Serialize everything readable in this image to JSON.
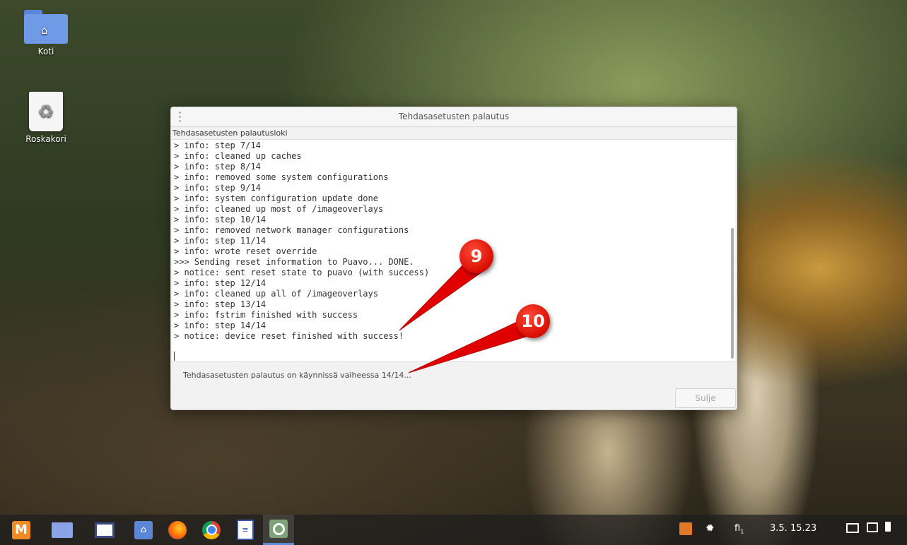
{
  "desktop": {
    "icons": [
      {
        "label": "Koti",
        "icon": "home-folder-icon"
      },
      {
        "label": "Roskakori",
        "icon": "trash-icon"
      }
    ]
  },
  "dialog": {
    "title": "Tehdasasetusten palautus",
    "log_label": "Tehdasasetusten palautusloki",
    "log_lines": [
      "> info: step 7/14",
      "> info: cleaned up caches",
      "> info: step 8/14",
      "> info: removed some system configurations",
      "> info: step 9/14",
      "> info: system configuration update done",
      "> info: cleaned up most of /imageoverlays",
      "> info: step 10/14",
      "> info: removed network manager configurations",
      "> info: step 11/14",
      "> info: wrote reset override",
      ">>> Sending reset information to Puavo... DONE.",
      "> notice: sent reset state to puavo (with success)",
      "> info: step 12/14",
      "> info: cleaned up all of /imageoverlays",
      "> info: step 13/14",
      "> info: fstrim finished with success",
      "> info: step 14/14",
      "> notice: device reset finished with success!"
    ],
    "status": "Tehdasasetusten palautus on käynnissä vaiheessa 14/14...",
    "close_label": "Sulje"
  },
  "annotations": {
    "callout_9": "9",
    "callout_10": "10",
    "color": "#e00000"
  },
  "taskbar": {
    "apps": [
      "menu-icon",
      "workspace-icon",
      "window-switcher-icon",
      "files-icon",
      "firefox-icon",
      "chrome-icon",
      "text-editor-icon",
      "reset-tool-icon"
    ],
    "keyboard_layout": "fi",
    "clock": "3.5. 15.23"
  }
}
